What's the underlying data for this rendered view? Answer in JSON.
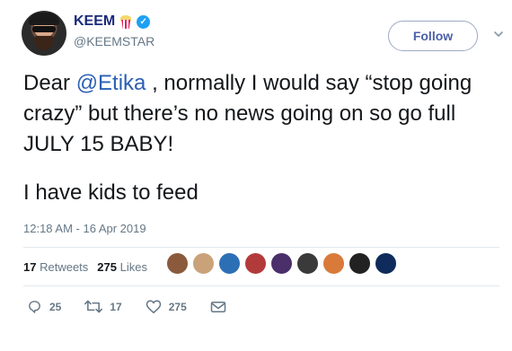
{
  "user": {
    "display_name": "KEEM",
    "handle": "@KEEMSTAR",
    "follow_label": "Follow"
  },
  "tweet": {
    "text_prefix": "Dear ",
    "mention": "@Etika",
    "text_rest": " , normally I would say “stop going crazy” but there’s no news going on so go full JULY 15 BABY!",
    "text_line2": "I have kids to feed",
    "timestamp": "12:18 AM - 16 Apr 2019"
  },
  "stats": {
    "retweets_count": "17",
    "retweets_label": "Retweets",
    "likes_count": "275",
    "likes_label": "Likes"
  },
  "liker_avatars": [
    {
      "color": "#8b5a3c"
    },
    {
      "color": "#c9a27a"
    },
    {
      "color": "#2d6fb5"
    },
    {
      "color": "#b33a3a"
    },
    {
      "color": "#4a2f6b"
    },
    {
      "color": "#3a3a3a"
    },
    {
      "color": "#d97a3a"
    },
    {
      "color": "#222222"
    },
    {
      "color": "#0f2b5b"
    }
  ],
  "actions": {
    "reply_count": "25",
    "retweet_count": "17",
    "like_count": "275"
  },
  "colors": {
    "accent": "#1da1f2",
    "mention": "#2b5fb4",
    "name": "#1c2a7a"
  }
}
